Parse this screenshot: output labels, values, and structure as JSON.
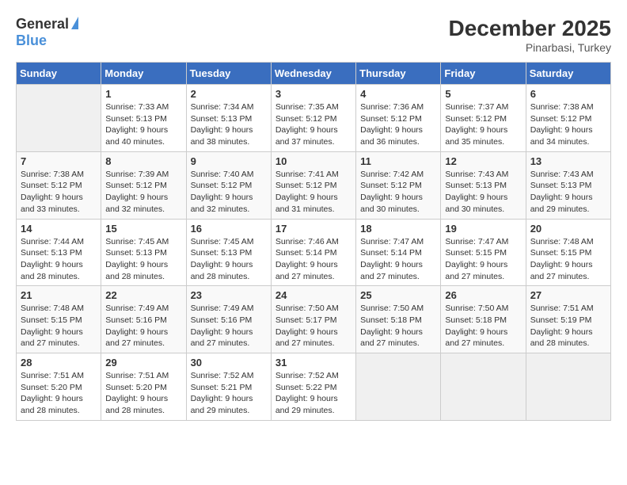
{
  "header": {
    "logo_general": "General",
    "logo_blue": "Blue",
    "month_title": "December 2025",
    "subtitle": "Pinarbasi, Turkey"
  },
  "days_of_week": [
    "Sunday",
    "Monday",
    "Tuesday",
    "Wednesday",
    "Thursday",
    "Friday",
    "Saturday"
  ],
  "weeks": [
    [
      {
        "day": "",
        "empty": true
      },
      {
        "day": "1",
        "sunrise": "Sunrise: 7:33 AM",
        "sunset": "Sunset: 5:13 PM",
        "daylight": "Daylight: 9 hours and 40 minutes."
      },
      {
        "day": "2",
        "sunrise": "Sunrise: 7:34 AM",
        "sunset": "Sunset: 5:13 PM",
        "daylight": "Daylight: 9 hours and 38 minutes."
      },
      {
        "day": "3",
        "sunrise": "Sunrise: 7:35 AM",
        "sunset": "Sunset: 5:12 PM",
        "daylight": "Daylight: 9 hours and 37 minutes."
      },
      {
        "day": "4",
        "sunrise": "Sunrise: 7:36 AM",
        "sunset": "Sunset: 5:12 PM",
        "daylight": "Daylight: 9 hours and 36 minutes."
      },
      {
        "day": "5",
        "sunrise": "Sunrise: 7:37 AM",
        "sunset": "Sunset: 5:12 PM",
        "daylight": "Daylight: 9 hours and 35 minutes."
      },
      {
        "day": "6",
        "sunrise": "Sunrise: 7:38 AM",
        "sunset": "Sunset: 5:12 PM",
        "daylight": "Daylight: 9 hours and 34 minutes."
      }
    ],
    [
      {
        "day": "7",
        "sunrise": "Sunrise: 7:38 AM",
        "sunset": "Sunset: 5:12 PM",
        "daylight": "Daylight: 9 hours and 33 minutes."
      },
      {
        "day": "8",
        "sunrise": "Sunrise: 7:39 AM",
        "sunset": "Sunset: 5:12 PM",
        "daylight": "Daylight: 9 hours and 32 minutes."
      },
      {
        "day": "9",
        "sunrise": "Sunrise: 7:40 AM",
        "sunset": "Sunset: 5:12 PM",
        "daylight": "Daylight: 9 hours and 32 minutes."
      },
      {
        "day": "10",
        "sunrise": "Sunrise: 7:41 AM",
        "sunset": "Sunset: 5:12 PM",
        "daylight": "Daylight: 9 hours and 31 minutes."
      },
      {
        "day": "11",
        "sunrise": "Sunrise: 7:42 AM",
        "sunset": "Sunset: 5:12 PM",
        "daylight": "Daylight: 9 hours and 30 minutes."
      },
      {
        "day": "12",
        "sunrise": "Sunrise: 7:43 AM",
        "sunset": "Sunset: 5:13 PM",
        "daylight": "Daylight: 9 hours and 30 minutes."
      },
      {
        "day": "13",
        "sunrise": "Sunrise: 7:43 AM",
        "sunset": "Sunset: 5:13 PM",
        "daylight": "Daylight: 9 hours and 29 minutes."
      }
    ],
    [
      {
        "day": "14",
        "sunrise": "Sunrise: 7:44 AM",
        "sunset": "Sunset: 5:13 PM",
        "daylight": "Daylight: 9 hours and 28 minutes."
      },
      {
        "day": "15",
        "sunrise": "Sunrise: 7:45 AM",
        "sunset": "Sunset: 5:13 PM",
        "daylight": "Daylight: 9 hours and 28 minutes."
      },
      {
        "day": "16",
        "sunrise": "Sunrise: 7:45 AM",
        "sunset": "Sunset: 5:13 PM",
        "daylight": "Daylight: 9 hours and 28 minutes."
      },
      {
        "day": "17",
        "sunrise": "Sunrise: 7:46 AM",
        "sunset": "Sunset: 5:14 PM",
        "daylight": "Daylight: 9 hours and 27 minutes."
      },
      {
        "day": "18",
        "sunrise": "Sunrise: 7:47 AM",
        "sunset": "Sunset: 5:14 PM",
        "daylight": "Daylight: 9 hours and 27 minutes."
      },
      {
        "day": "19",
        "sunrise": "Sunrise: 7:47 AM",
        "sunset": "Sunset: 5:15 PM",
        "daylight": "Daylight: 9 hours and 27 minutes."
      },
      {
        "day": "20",
        "sunrise": "Sunrise: 7:48 AM",
        "sunset": "Sunset: 5:15 PM",
        "daylight": "Daylight: 9 hours and 27 minutes."
      }
    ],
    [
      {
        "day": "21",
        "sunrise": "Sunrise: 7:48 AM",
        "sunset": "Sunset: 5:15 PM",
        "daylight": "Daylight: 9 hours and 27 minutes."
      },
      {
        "day": "22",
        "sunrise": "Sunrise: 7:49 AM",
        "sunset": "Sunset: 5:16 PM",
        "daylight": "Daylight: 9 hours and 27 minutes."
      },
      {
        "day": "23",
        "sunrise": "Sunrise: 7:49 AM",
        "sunset": "Sunset: 5:16 PM",
        "daylight": "Daylight: 9 hours and 27 minutes."
      },
      {
        "day": "24",
        "sunrise": "Sunrise: 7:50 AM",
        "sunset": "Sunset: 5:17 PM",
        "daylight": "Daylight: 9 hours and 27 minutes."
      },
      {
        "day": "25",
        "sunrise": "Sunrise: 7:50 AM",
        "sunset": "Sunset: 5:18 PM",
        "daylight": "Daylight: 9 hours and 27 minutes."
      },
      {
        "day": "26",
        "sunrise": "Sunrise: 7:50 AM",
        "sunset": "Sunset: 5:18 PM",
        "daylight": "Daylight: 9 hours and 27 minutes."
      },
      {
        "day": "27",
        "sunrise": "Sunrise: 7:51 AM",
        "sunset": "Sunset: 5:19 PM",
        "daylight": "Daylight: 9 hours and 28 minutes."
      }
    ],
    [
      {
        "day": "28",
        "sunrise": "Sunrise: 7:51 AM",
        "sunset": "Sunset: 5:20 PM",
        "daylight": "Daylight: 9 hours and 28 minutes."
      },
      {
        "day": "29",
        "sunrise": "Sunrise: 7:51 AM",
        "sunset": "Sunset: 5:20 PM",
        "daylight": "Daylight: 9 hours and 28 minutes."
      },
      {
        "day": "30",
        "sunrise": "Sunrise: 7:52 AM",
        "sunset": "Sunset: 5:21 PM",
        "daylight": "Daylight: 9 hours and 29 minutes."
      },
      {
        "day": "31",
        "sunrise": "Sunrise: 7:52 AM",
        "sunset": "Sunset: 5:22 PM",
        "daylight": "Daylight: 9 hours and 29 minutes."
      },
      {
        "day": "",
        "empty": true
      },
      {
        "day": "",
        "empty": true
      },
      {
        "day": "",
        "empty": true
      }
    ]
  ]
}
